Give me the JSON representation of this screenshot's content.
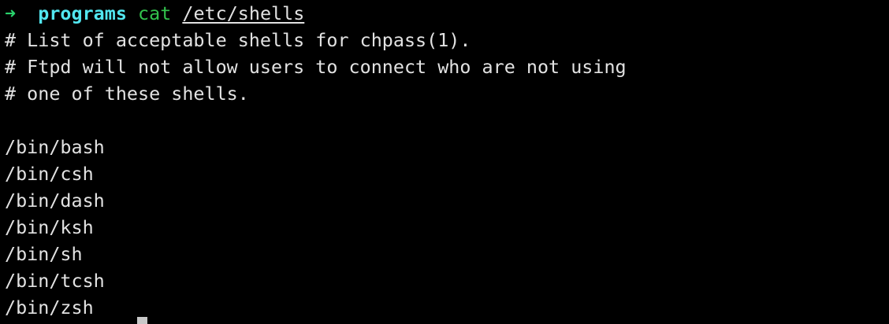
{
  "prompt": {
    "arrow": "➜",
    "directory": "programs",
    "command": "cat",
    "argument": "/etc/shells"
  },
  "output": [
    "# List of acceptable shells for chpass(1).",
    "# Ftpd will not allow users to connect who are not using",
    "# one of these shells.",
    "",
    "/bin/bash",
    "/bin/csh",
    "/bin/dash",
    "/bin/ksh",
    "/bin/sh",
    "/bin/tcsh",
    "/bin/zsh"
  ],
  "colors": {
    "background": "#000000",
    "text": "#e2e2e2",
    "arrow": "#29d36c",
    "directory": "#52e7f0",
    "command": "#33c24d",
    "cursor": "#c8c8c8"
  }
}
